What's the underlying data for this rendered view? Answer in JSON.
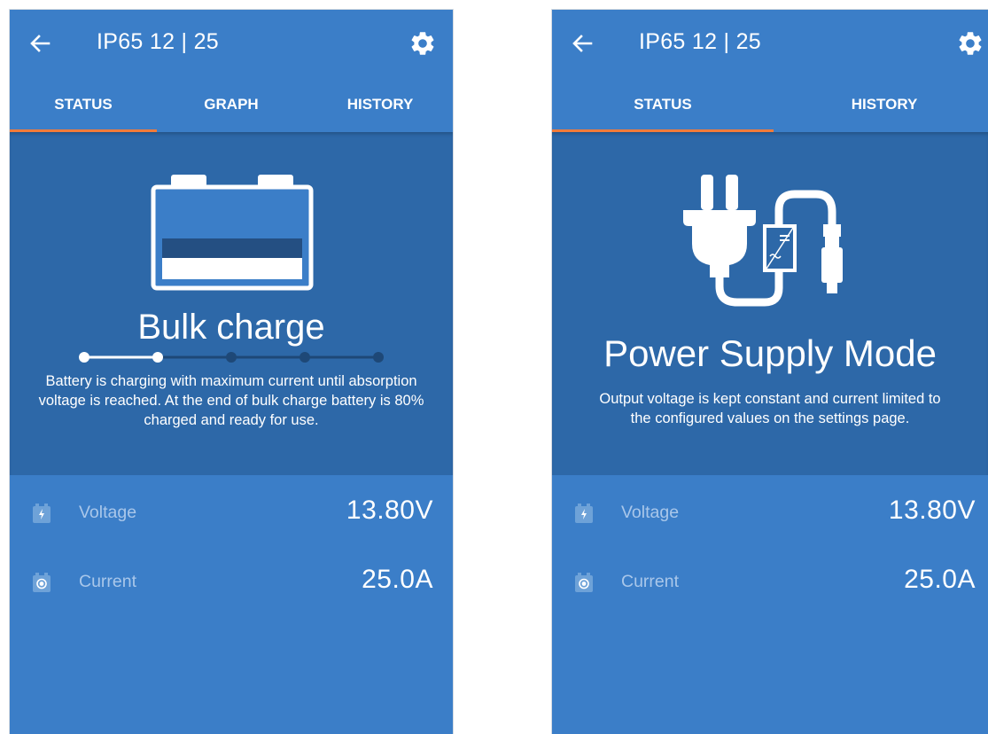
{
  "screens": [
    {
      "title": "IP65 12 | 25",
      "tabs": [
        "STATUS",
        "GRAPH",
        "HISTORY"
      ],
      "active_tab": "STATUS",
      "state_title": "Bulk charge",
      "state_desc": "Battery is charging with maximum current until absorption voltage is reached. At the end of bulk charge battery is 80% charged and ready for use.",
      "progress": {
        "steps": 5,
        "current_step": 2
      },
      "hero_icon": "battery-icon",
      "readings": [
        {
          "label": "Voltage",
          "value": "13.80V",
          "icon": "voltage-icon"
        },
        {
          "label": "Current",
          "value": "25.0A",
          "icon": "current-icon"
        }
      ]
    },
    {
      "title": "IP65 12 | 25",
      "tabs": [
        "STATUS",
        "HISTORY"
      ],
      "active_tab": "STATUS",
      "state_title": "Power Supply Mode",
      "state_desc": "Output voltage is kept constant and current limited to the configured values on the settings page.",
      "hero_icon": "power-supply-plug-icon",
      "readings": [
        {
          "label": "Voltage",
          "value": "13.80V",
          "icon": "voltage-icon"
        },
        {
          "label": "Current",
          "value": "25.0A",
          "icon": "current-icon"
        }
      ]
    }
  ],
  "colors": {
    "app_bar": "#3b7ec8",
    "hero_bg": "#2d68a8",
    "tab_indicator": "#f27b3a",
    "label": "#a9c7ea",
    "text": "#ffffff"
  }
}
